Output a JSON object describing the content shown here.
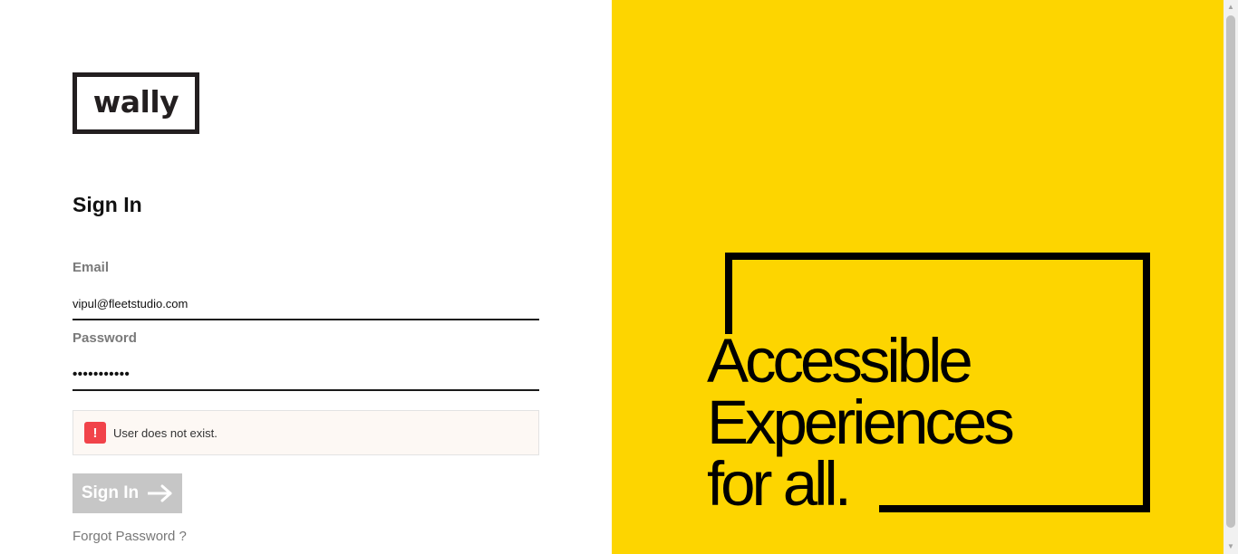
{
  "brand": {
    "logo_text": "wally"
  },
  "form": {
    "title": "Sign In",
    "email": {
      "label": "Email",
      "value": "vipul@fleetstudio.com"
    },
    "password": {
      "label": "Password",
      "value": "•••••••••••"
    },
    "error": {
      "icon": "exclamation-icon",
      "message": "User does not exist."
    },
    "submit": {
      "label": "Sign In",
      "icon": "arrow-right-icon",
      "state": "disabled"
    },
    "forgot_link": "Forgot Password ?"
  },
  "hero": {
    "lines": [
      "Accessible",
      "Experiences",
      "for all."
    ],
    "background_color": "#fdd500"
  },
  "colors": {
    "error": "#f1434a",
    "button_disabled": "#c6c6c6",
    "text_dark": "#111111"
  }
}
